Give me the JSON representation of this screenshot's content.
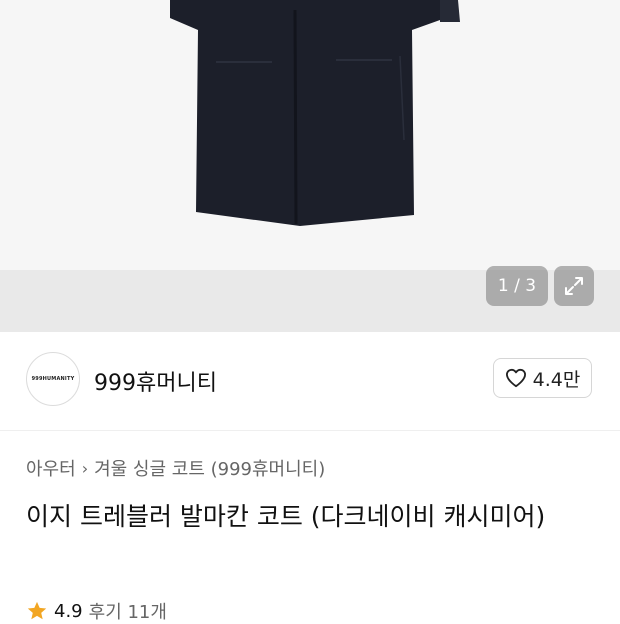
{
  "gallery": {
    "counter": "1 / 3",
    "expand_icon": "expand-icon"
  },
  "shop": {
    "logo_text": "999HUMANITY",
    "name": "999휴머니티",
    "like_count": "4.4만",
    "like_icon": "heart-outline-icon"
  },
  "product": {
    "breadcrumb": [
      "아우터",
      "겨울 싱글 코트 (999휴머니티)"
    ],
    "title": "이지 트레블러 발마칸 코트 (다크네이비 캐시미어)",
    "rating": "4.9",
    "review_count": "후기 11개",
    "star_color": "#f2a623"
  },
  "colors": {
    "coat": "#1c1f2a",
    "image_bg": "#f6f6f6"
  }
}
